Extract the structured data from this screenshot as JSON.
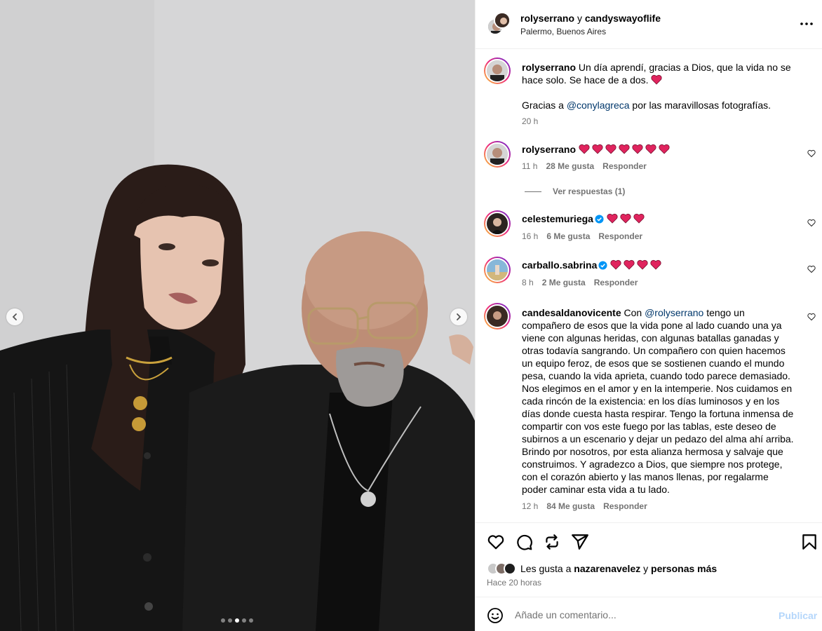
{
  "post": {
    "authors": {
      "user1": "rolyserrano",
      "conjunction": "y",
      "user2": "candyswayoflife"
    },
    "location": "Palermo, Buenos Aires",
    "carousel": {
      "count": 5,
      "active_index": 2
    }
  },
  "caption": {
    "username": "rolyserrano",
    "text_line1": " Un día aprendí, gracias a Dios, que la vida no se hace solo. Se hace de a dos. ",
    "text2_prefix": "Gracias a ",
    "mention": "@conylagreca",
    "text2_suffix": " por las maravillosas fotografías.",
    "time": "20 h"
  },
  "comments": [
    {
      "username": "rolyserrano",
      "verified": false,
      "hearts": 7,
      "text": "",
      "time": "11 h",
      "likes": "28 Me gusta",
      "reply": "Responder"
    },
    {
      "username": "celestemuriega",
      "verified": true,
      "hearts": 3,
      "text": "",
      "time": "16 h",
      "likes": "6 Me gusta",
      "reply": "Responder"
    },
    {
      "username": "carballo.sabrina",
      "verified": true,
      "hearts": 4,
      "text": "",
      "time": "8 h",
      "likes": "2 Me gusta",
      "reply": "Responder"
    },
    {
      "username": "candesaldanovicente",
      "verified": false,
      "text_prefix": " Con ",
      "mention": "@rolyserrano",
      "text_rest": " tengo un compañero de esos que la vida pone al lado cuando una ya viene con algunas heridas, con algunas batallas ganadas y otras todavía sangrando. Un compañero con quien hacemos un equipo feroz, de esos que se sostienen cuando el mundo pesa, cuando la vida aprieta, cuando todo parece demasiado.",
      "text_p2": "Nos elegimos en el amor y en la intemperie. Nos cuidamos en cada rincón de la existencia: en los días luminosos y en los días donde cuesta hasta respirar. Tengo la fortuna inmensa de compartir con vos este fuego por las tablas, este deseo de subirnos a un escenario y dejar un pedazo del alma ahí arriba. Brindo por nosotros, por esta alianza hermosa y salvaje que construimos. Y agradezco a Dios, que siempre nos protege, con el corazón abierto y las manos llenas, por regalarme poder caminar esta vida a tu lado.",
      "time": "12 h",
      "likes": "84 Me gusta",
      "reply": "Responder"
    }
  ],
  "view_replies": "Ver respuestas (1)",
  "likes_summary": {
    "prefix": "Les gusta a ",
    "user": "nazarenavelez",
    "conj": " y ",
    "others": "personas más"
  },
  "posted_ago": "Hace 20 horas",
  "comment_box": {
    "placeholder": "Añade un comentario...",
    "publish": "Publicar"
  },
  "colors": {
    "heart": "#e0245e",
    "verified": "#0095f6",
    "mention": "#00376b",
    "publish_disabled": "#b4d6fb"
  },
  "icons": [
    "chevron-left-icon",
    "chevron-right-icon",
    "more-icon",
    "heart-icon",
    "comment-icon",
    "repost-icon",
    "share-icon",
    "bookmark-icon",
    "emoji-icon",
    "verified-icon"
  ]
}
